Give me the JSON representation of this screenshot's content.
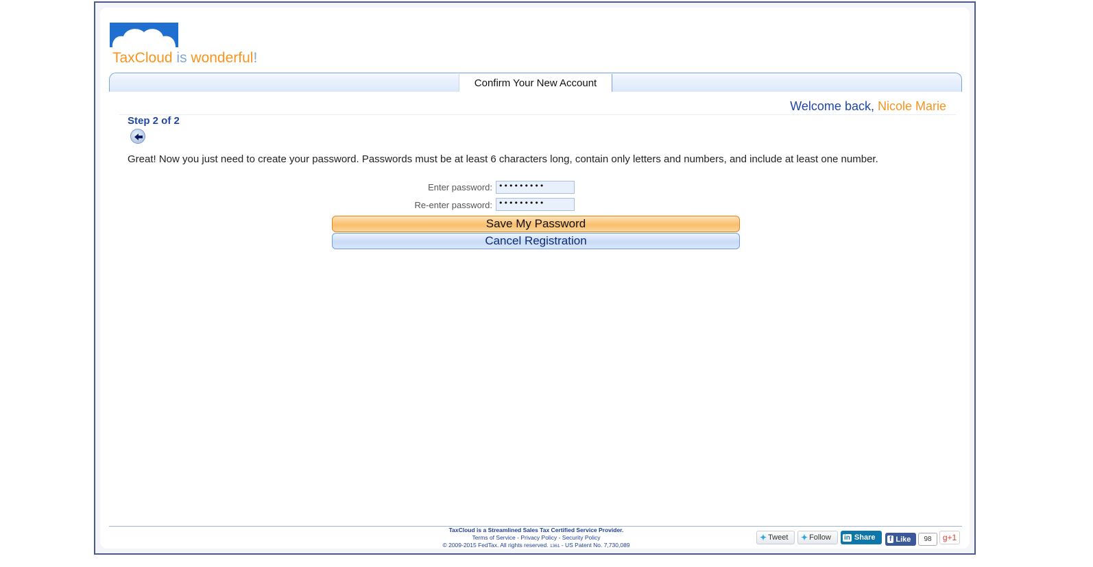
{
  "logo": {
    "brand": "TaxCloud",
    "is": " is ",
    "wonderful": "wonderful",
    "bang": "!"
  },
  "title_tab": "Confirm Your New Account",
  "welcome": {
    "prefix": "Welcome back, ",
    "name": "Nicole Marie"
  },
  "step_label": "Step 2 of 2",
  "instructions": "Great! Now you just need to create your password. Passwords must be at least 6 characters long, contain only letters and numbers, and include at least one number.",
  "form": {
    "password_label": "Enter password:",
    "password_value": "•••••••••",
    "reenter_label": "Re-enter password:",
    "reenter_value": "•••••••••"
  },
  "buttons": {
    "save": "Save My Password",
    "cancel": "Cancel Registration"
  },
  "footer": {
    "line1": "TaxCloud is a Streamlined Sales Tax Certified Service Provider.",
    "terms": "Terms of Service",
    "privacy": "Privacy Policy",
    "security": "Security Policy",
    "separator": " - ",
    "copyright": "© 2009-2015 FedTax. All rights reserved.",
    "build": "1361",
    "patent": "US Patent No. 7,730,089"
  },
  "social": {
    "tweet": "Tweet",
    "follow": "Follow",
    "share": "Share",
    "like": "Like",
    "like_count": "98",
    "gplus": "g+1"
  },
  "colors": {
    "brand_orange": "#f7941d",
    "brand_blue": "#1f47a8",
    "frame_border": "#4a5a8a"
  }
}
